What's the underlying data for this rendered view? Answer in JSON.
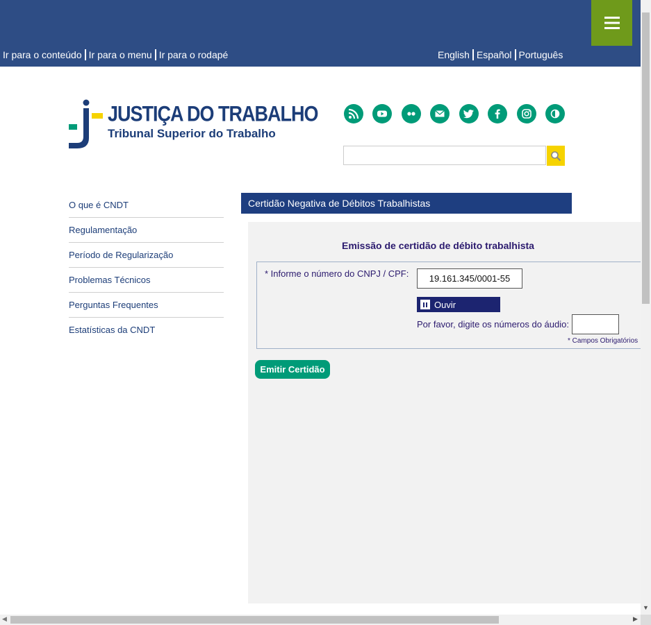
{
  "skip_links": [
    "Ir para o conteúdo",
    "Ir para o menu",
    "Ir para o rodapé"
  ],
  "languages": [
    "English",
    "Español",
    "Português"
  ],
  "logo": {
    "title": "JUSTIÇA DO TRABALHO",
    "subtitle": "Tribunal Superior do Trabalho"
  },
  "social_icons": [
    "rss-icon",
    "youtube-icon",
    "flickr-icon",
    "email-icon",
    "twitter-icon",
    "facebook-icon",
    "instagram-icon",
    "contrast-icon"
  ],
  "search": {
    "value": "",
    "icon": "search-icon"
  },
  "sidebar": {
    "items": [
      "O que é CNDT",
      "Regulamentação",
      "Período de Regularização",
      "Problemas Técnicos",
      "Perguntas Frequentes",
      "Estatísticas da CNDT"
    ]
  },
  "page": {
    "header": "Certidão Negativa de Débitos Trabalhistas"
  },
  "form": {
    "title": "Emissão de certidão de débito trabalhista",
    "cnpj_label": "* Informe o número do CNPJ / CPF:",
    "cnpj_value": "19.161.345/0001-55",
    "listen_label": "Ouvir",
    "audio_label": "Por favor, digite os números do áudio:",
    "audio_value": "",
    "required_note": "* Campos Obrigatórios",
    "submit_label": "Emitir Certidão"
  },
  "colors": {
    "topbar": "#2e4d85",
    "menu_button": "#6f9a1b",
    "social": "#009b78",
    "header": "#1e3e80",
    "search_button": "#f6d300"
  }
}
